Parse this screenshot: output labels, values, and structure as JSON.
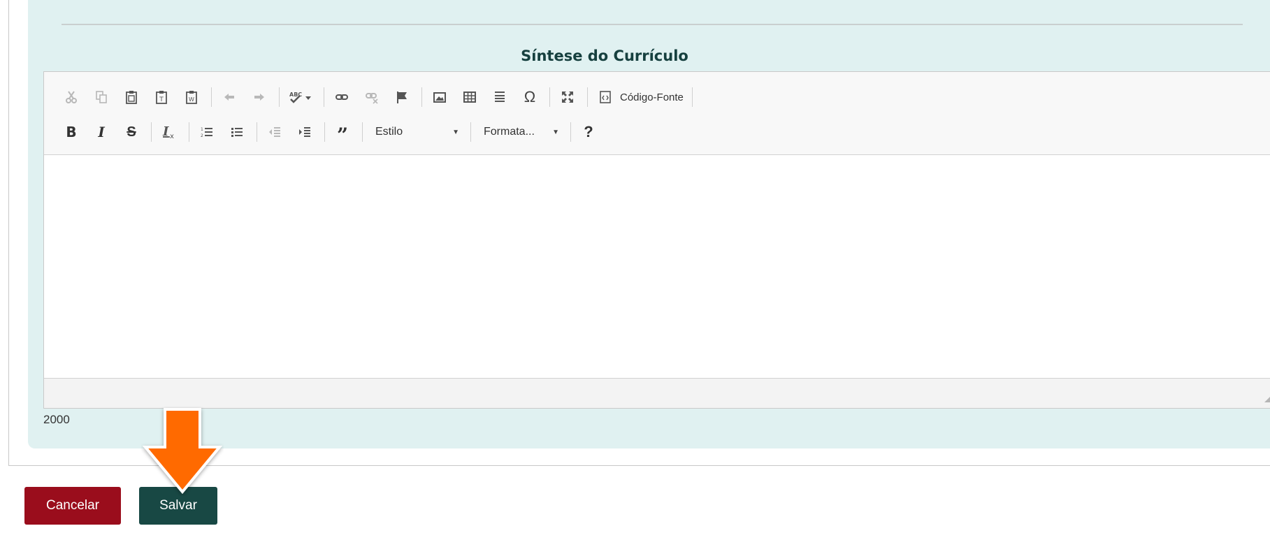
{
  "section": {
    "title": "Síntese do Currículo"
  },
  "toolbar": {
    "source_label": "Código-Fonte",
    "style_combo": "Estilo",
    "format_combo": "Formata...",
    "help": "?"
  },
  "editor": {
    "content": ""
  },
  "counter": "2000",
  "actions": {
    "cancel_label": "Cancelar",
    "save_label": "Salvar"
  },
  "colors": {
    "panel_bg": "#e0f1f1",
    "title": "#16403f",
    "cancel": "#9a0d1c",
    "save": "#184844",
    "arrow": "#ff6a00"
  }
}
